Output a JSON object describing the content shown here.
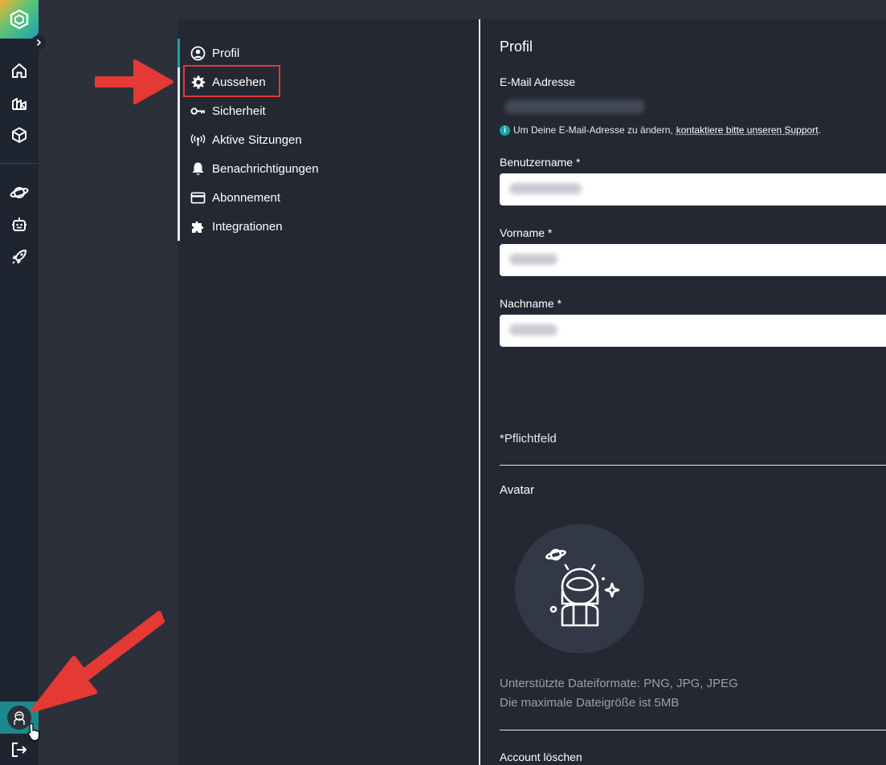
{
  "nav": {
    "items": [
      {
        "label": "Profil",
        "icon": "user-circle-icon",
        "active": true
      },
      {
        "label": "Aussehen",
        "icon": "gear-icon",
        "active": false
      },
      {
        "label": "Sicherheit",
        "icon": "key-icon",
        "active": false
      },
      {
        "label": "Aktive Sitzungen",
        "icon": "broadcast-icon",
        "active": false
      },
      {
        "label": "Benachrichtigungen",
        "icon": "bell-icon",
        "active": false
      },
      {
        "label": "Abonnement",
        "icon": "credit-card-icon",
        "active": false
      },
      {
        "label": "Integrationen",
        "icon": "puzzle-icon",
        "active": false
      }
    ]
  },
  "profile": {
    "title": "Profil",
    "email_label": "E-Mail Adresse",
    "email_info_prefix": "Um Deine E-Mail-Adresse zu ändern,",
    "email_info_link": "kontaktiere bitte unseren Support",
    "email_info_suffix": ".",
    "username_label": "Benutzername *",
    "firstname_label": "Vorname *",
    "lastname_label": "Nachname *",
    "required_note": "*Pflichtfeld"
  },
  "avatar": {
    "title": "Avatar",
    "formats_note": "Unterstützte Dateiformate: PNG, JPG, JPEG",
    "size_note": "Die maximale Dateigröße ist 5MB"
  },
  "delete": {
    "title": "Account löschen"
  },
  "colors": {
    "accent": "#19a5a5",
    "annotation": "#e53935",
    "background": "#2b303b",
    "panel": "#232833"
  }
}
